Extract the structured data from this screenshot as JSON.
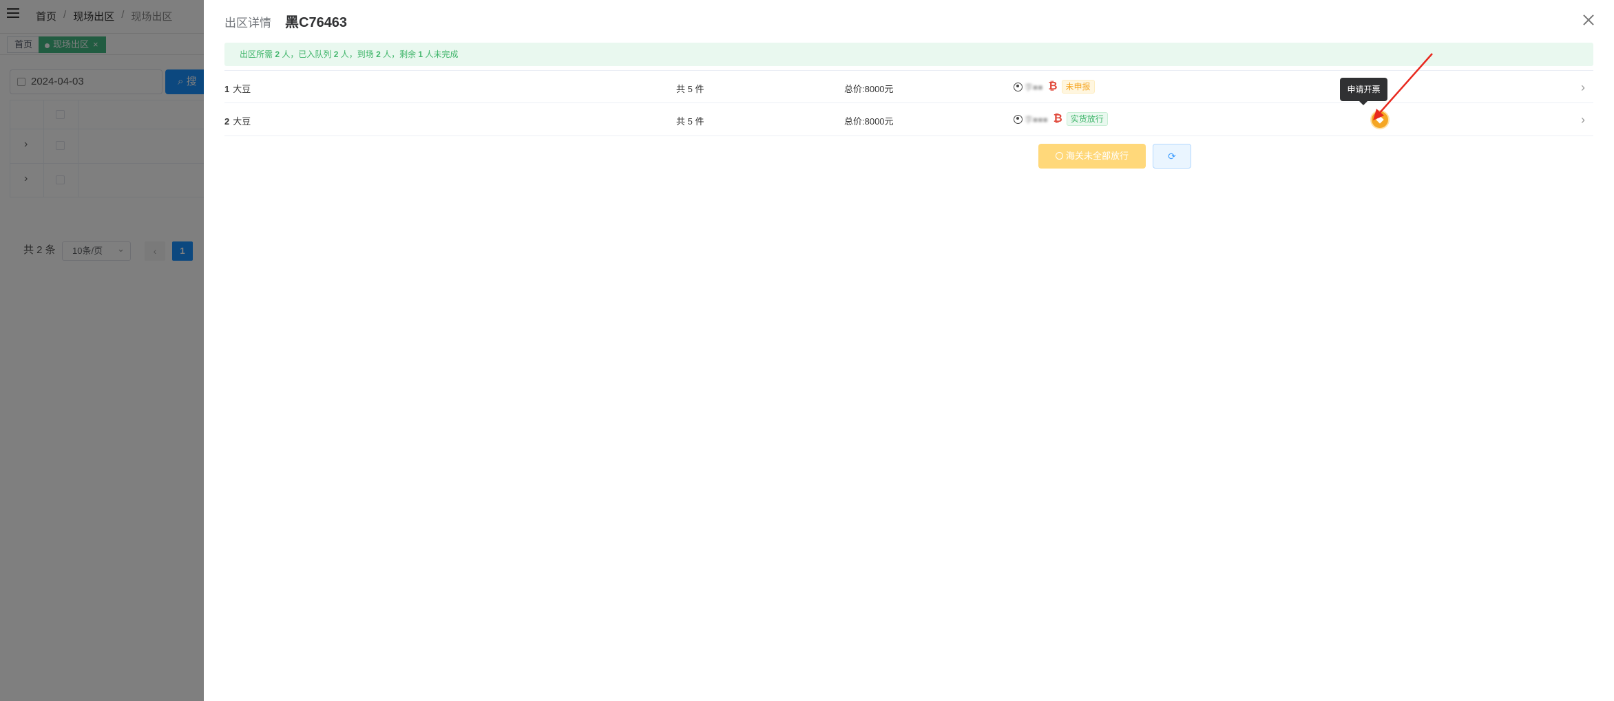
{
  "bg": {
    "breadcrumb": [
      "首页",
      "现场出区",
      "现场出区"
    ],
    "tags": {
      "home": "首页",
      "active": "现场出区",
      "active_close": "×"
    },
    "date_value": "2024-04-03",
    "search_label": "搜",
    "pager": {
      "total": "共 2 条",
      "size": "10条/页",
      "prev": "‹",
      "current": "1"
    }
  },
  "drawer": {
    "label": "出区详情",
    "title": "黑C76463",
    "alert": {
      "p1": "出区所需 ",
      "n1": "2",
      "p2": " 人，已入队列 ",
      "n2": "2",
      "p3": " 人，到场 ",
      "n3": "2",
      "p4": " 人，剩余 ",
      "n4": "1",
      "p5": " 人未完成"
    },
    "items": [
      {
        "index": "1",
        "name": "大豆",
        "count": "共 5 件",
        "price": "总价:8000元",
        "person": "李■■",
        "status": "未申报"
      },
      {
        "index": "2",
        "name": "大豆",
        "count": "共 5 件",
        "price": "总价:8000元",
        "person": "李■■■",
        "status": "实货放行"
      }
    ],
    "tooltip": "申请开票",
    "btn_release": "海关未全部放行",
    "btn_refresh": "⟳"
  },
  "colors": {
    "accent": "#1890ff",
    "success": "#3fb56a",
    "warning": "#f5a623",
    "danger": "#e0483a",
    "annotation": "#e8281e"
  },
  "icons": [
    "menu-icon",
    "calendar-icon",
    "close-icon",
    "user-icon",
    "bitcoin-icon",
    "invoice-icon",
    "chevron-right-icon",
    "ban-icon",
    "refresh-icon",
    "arrow-annotation-icon"
  ]
}
